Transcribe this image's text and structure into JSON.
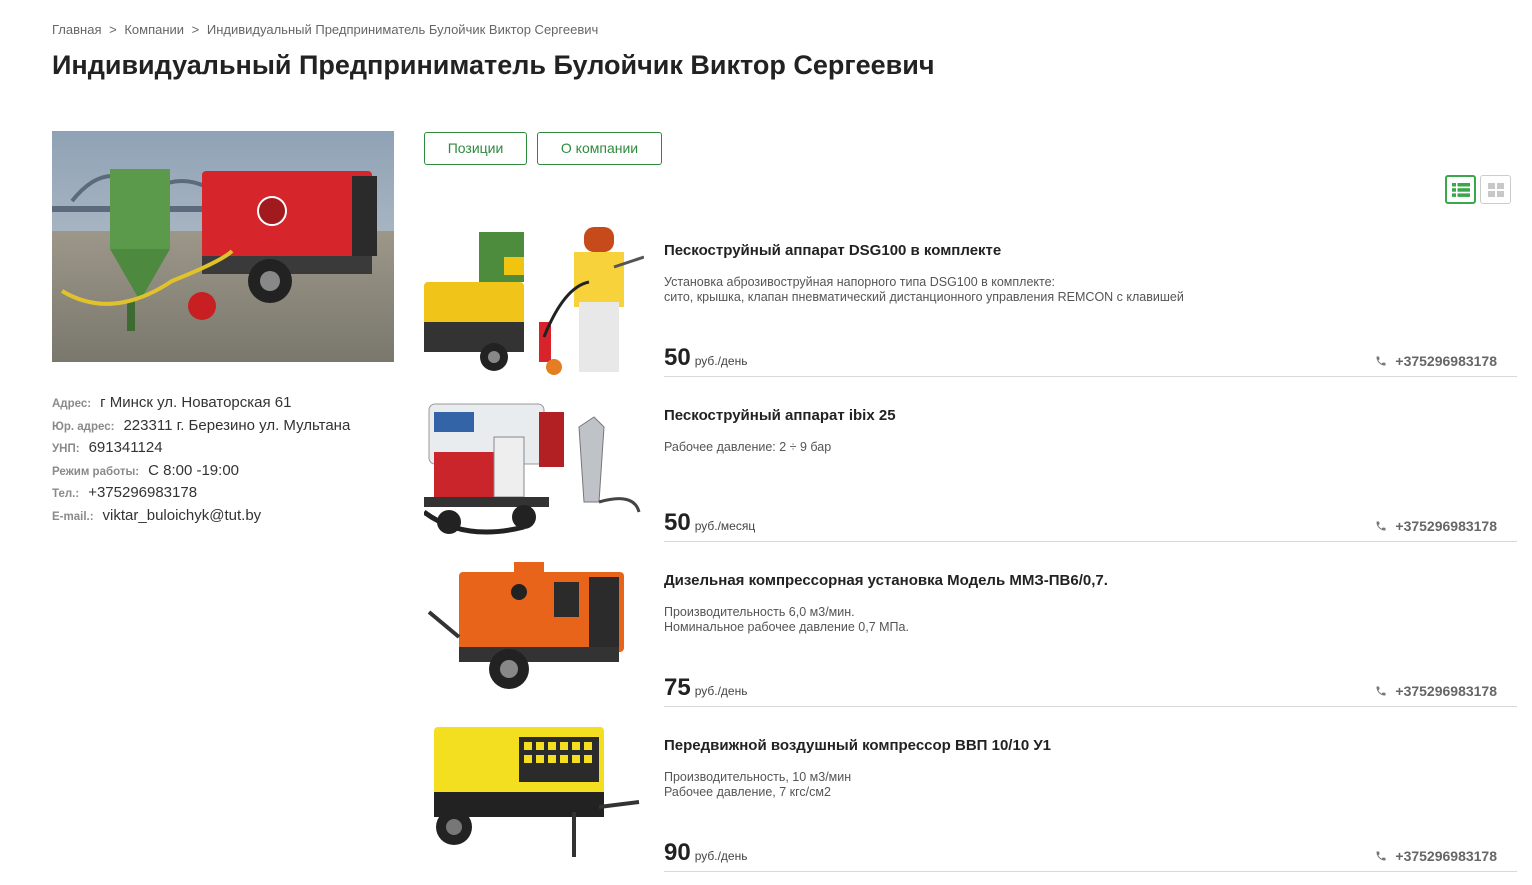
{
  "breadcrumb": {
    "home": "Главная",
    "separator": ">",
    "companies": "Компании",
    "current": "Индивидуальный Предприниматель Булойчик Виктор Сергеевич"
  },
  "page_title": "Индивидуальный Предприниматель Булойчик Виктор Сергеевич",
  "company_info": {
    "address_label": "Адрес:",
    "address": "г Минск ул. Новаторская 61",
    "legal_address_label": "Юр. адрес:",
    "legal_address": "223311 г. Березино ул. Мультана",
    "unp_label": "УНП:",
    "unp": "691341124",
    "hours_label": "Режим работы:",
    "hours": "С 8:00 -19:00",
    "phone_label": "Тел.:",
    "phone": "+375296983178",
    "email_label": "E-mail.:",
    "email": "viktar_buloichyk@tut.by"
  },
  "tabs": {
    "positions": "Позиции",
    "about": "О компании"
  },
  "view_toggle": {
    "active": "list-view-icon",
    "inactive": "grid-view-icon"
  },
  "colors": {
    "accent_green": "#2e8b3e",
    "text_dark": "#222222",
    "text_muted": "#8a8a8a"
  },
  "products": [
    {
      "title": "Пескоструйный аппарат DSG100 в комплекте",
      "desc": [
        "Установка аброзивоструйная напорного типа DSG100 в комплекте:",
        "сито, крышка, клапан пневматический дистанционного управления REMCON с клавишей"
      ],
      "price": "50",
      "unit": "руб./день",
      "phone": "+375296983178"
    },
    {
      "title": "Пескоструйный аппарат ibix 25",
      "desc": [
        "Рабочее давление: 2 ÷ 9 бар"
      ],
      "price": "50",
      "unit": "руб./месяц",
      "phone": "+375296983178"
    },
    {
      "title": "Дизельная компрессорная установка Модель ММЗ-ПВ6/0,7.",
      "desc": [
        "Производительность 6,0 м3/мин.",
        "Номинальное рабочее давление 0,7 МПа."
      ],
      "price": "75",
      "unit": "руб./день",
      "phone": "+375296983178"
    },
    {
      "title": "Передвижной воздушный компрессор ВВП 10/10 У1",
      "desc": [
        "Производительность, 10 м3/мин",
        "Рабочее давление, 7 кгс/см2"
      ],
      "price": "90",
      "unit": "руб./день",
      "phone": "+375296983178"
    }
  ]
}
